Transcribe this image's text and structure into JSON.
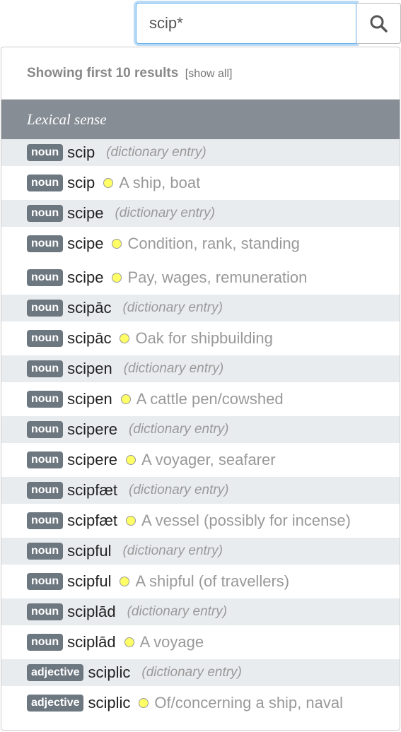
{
  "search": {
    "value": "scip*",
    "button_icon": "search-icon"
  },
  "results": {
    "summary": "Showing first 10 results",
    "show_all_label": "[show all]",
    "section_label": "Lexical sense",
    "rows": [
      {
        "pos": "noun",
        "lemma": "scip",
        "note": "(dictionary entry)",
        "gloss": ""
      },
      {
        "pos": "noun",
        "lemma": "scip",
        "note": "",
        "gloss": "A ship, boat"
      },
      {
        "pos": "noun",
        "lemma": "scipe",
        "note": "(dictionary entry)",
        "gloss": ""
      },
      {
        "pos": "noun",
        "lemma": "scipe",
        "note": "",
        "gloss": "Condition, rank, standing"
      },
      {
        "pos": "noun",
        "lemma": "scipe",
        "note": "",
        "gloss": "Pay, wages, remuneration"
      },
      {
        "pos": "noun",
        "lemma": "scipāc",
        "note": "(dictionary entry)",
        "gloss": ""
      },
      {
        "pos": "noun",
        "lemma": "scipāc",
        "note": "",
        "gloss": "Oak for shipbuilding"
      },
      {
        "pos": "noun",
        "lemma": "scipen",
        "note": "(dictionary entry)",
        "gloss": ""
      },
      {
        "pos": "noun",
        "lemma": "scipen",
        "note": "",
        "gloss": "A cattle pen/cowshed"
      },
      {
        "pos": "noun",
        "lemma": "scipere",
        "note": "(dictionary entry)",
        "gloss": ""
      },
      {
        "pos": "noun",
        "lemma": "scipere",
        "note": "",
        "gloss": "A voyager, seafarer"
      },
      {
        "pos": "noun",
        "lemma": "scipfæt",
        "note": "(dictionary entry)",
        "gloss": ""
      },
      {
        "pos": "noun",
        "lemma": "scipfæt",
        "note": "",
        "gloss": "A vessel (possibly for incense)"
      },
      {
        "pos": "noun",
        "lemma": "scipful",
        "note": "(dictionary entry)",
        "gloss": ""
      },
      {
        "pos": "noun",
        "lemma": "scipful",
        "note": "",
        "gloss": "A shipful (of travellers)"
      },
      {
        "pos": "noun",
        "lemma": "sciplād",
        "note": "(dictionary entry)",
        "gloss": ""
      },
      {
        "pos": "noun",
        "lemma": "sciplād",
        "note": "",
        "gloss": "A voyage"
      },
      {
        "pos": "adjective",
        "lemma": "sciplic",
        "note": "(dictionary entry)",
        "gloss": ""
      },
      {
        "pos": "adjective",
        "lemma": "sciplic",
        "note": "",
        "gloss": "Of/concerning a ship, naval"
      }
    ]
  },
  "colors": {
    "badge": "#6d7780",
    "section_header": "#868d94",
    "sense_dot": "#ffff66",
    "focus_ring": "#66afe9"
  }
}
